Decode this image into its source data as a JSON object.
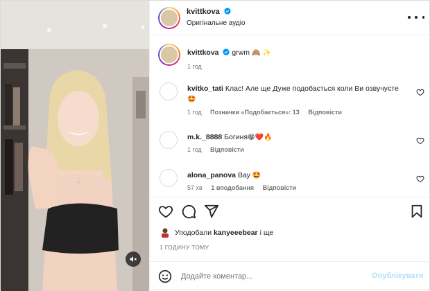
{
  "post": {
    "author": "kvittkova",
    "audio": "Оригінальне аудіо"
  },
  "caption": {
    "username": "kvittkova",
    "text": "grwm",
    "emojis": "🙈 ✨",
    "time": "1 год"
  },
  "comments": [
    {
      "username": "kvitko_tati",
      "text": "Клас! Але ще Дуже подобається коли Ви озвучуєте",
      "emoji": "🤩",
      "time": "1 год",
      "likes": "Позначки «Подобається»: 13",
      "reply": "Відповісти"
    },
    {
      "username": "m.k._8888",
      "text": "Богиня",
      "emoji": "😁❤️🔥",
      "time": "1 год",
      "reply": "Відповісти"
    },
    {
      "username": "alona_panova",
      "text": "Вау",
      "emoji": "🤩",
      "time": "57 хв",
      "likes": "1 вподобання",
      "reply": "Відповісти"
    }
  ],
  "likes_line": {
    "prefix": "Уподобали",
    "user": "kanyeeebear",
    "suffix": "і ще"
  },
  "timestamp": "1 ГОДИНУ ТОМУ",
  "composer": {
    "placeholder": "Додайте коментар...",
    "publish_label": "Опублікувати"
  },
  "colors": {
    "accent": "#0095f6",
    "publish_disabled": "#b2dffc",
    "secondary_text": "#737373",
    "like_red": "#ed4956"
  },
  "icons": {
    "header_more": "more-horizontal-icon",
    "comment_like": "heart-outline-icon",
    "actions": [
      "heart-icon",
      "comment-icon",
      "share-icon",
      "bookmark-icon"
    ],
    "media": "mute-icon",
    "composer": "emoji-icon"
  }
}
